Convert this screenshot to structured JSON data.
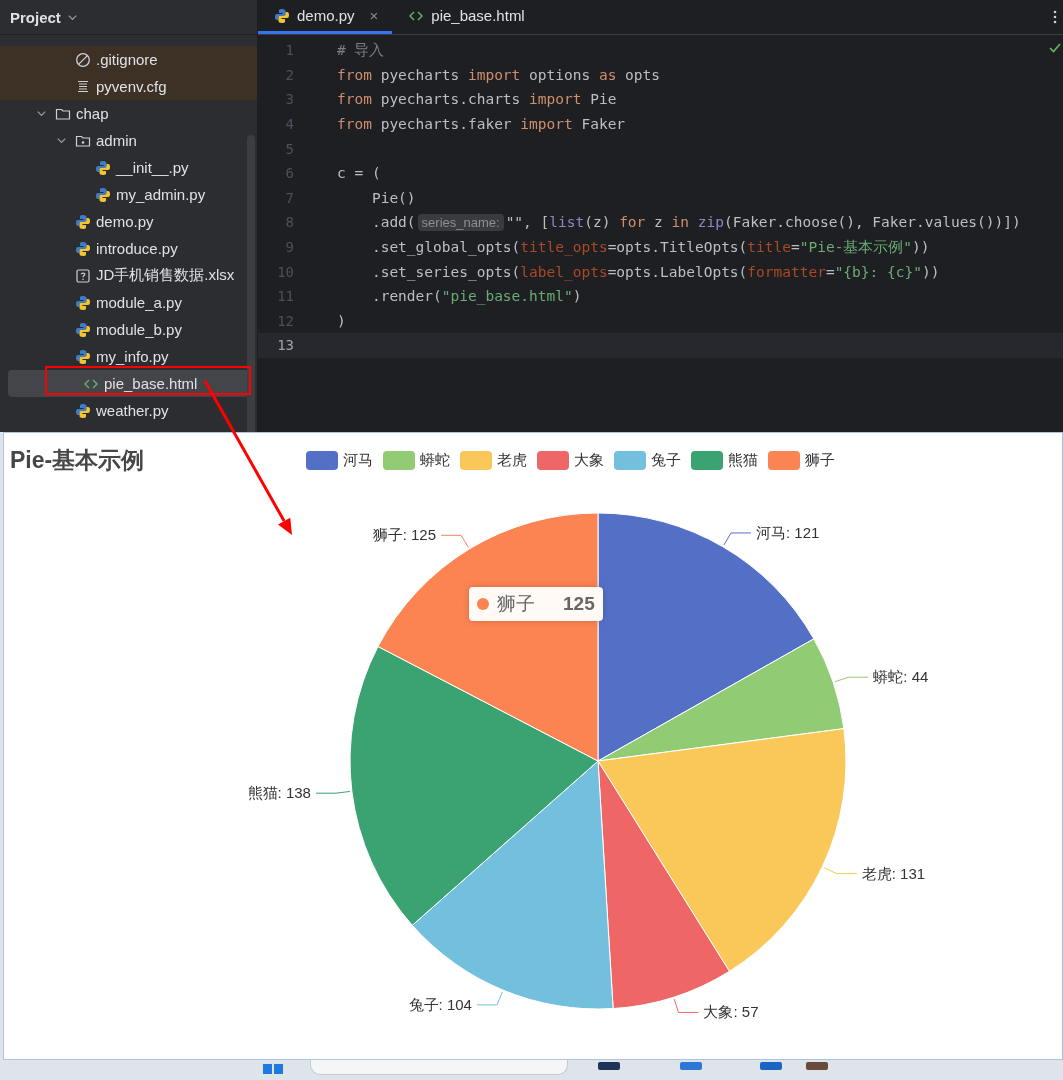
{
  "project_panel": {
    "title": "Project",
    "tree": [
      {
        "children": [
          {
            "label": ".gitignore",
            "kind": "ignore",
            "excluded": true,
            "selected": false
          },
          {
            "label": "pyvenv.cfg",
            "kind": "config",
            "excluded": true,
            "selected": false
          }
        ]
      },
      {
        "label": "chap",
        "kind": "folder",
        "expanded": true,
        "excluded": false,
        "selected": false,
        "children": [
          {
            "label": "admin",
            "kind": "package",
            "expanded": true,
            "excluded": false,
            "selected": false,
            "children": [
              {
                "label": "__init__.py",
                "kind": "python",
                "excluded": false,
                "selected": false
              },
              {
                "label": "my_admin.py",
                "kind": "python",
                "excluded": false,
                "selected": false
              }
            ]
          },
          {
            "label": "demo.py",
            "kind": "python",
            "excluded": false,
            "selected": false
          },
          {
            "label": "introduce.py",
            "kind": "python",
            "excluded": false,
            "selected": false
          },
          {
            "label": "JD手机销售数据.xlsx",
            "kind": "unknown",
            "excluded": false,
            "selected": false
          },
          {
            "label": "module_a.py",
            "kind": "python",
            "excluded": false,
            "selected": false
          },
          {
            "label": "module_b.py",
            "kind": "python",
            "excluded": false,
            "selected": false
          },
          {
            "label": "my_info.py",
            "kind": "python",
            "excluded": false,
            "selected": false
          },
          {
            "label": "pie_base.html",
            "kind": "html",
            "excluded": false,
            "selected": true
          },
          {
            "label": "weather.py",
            "kind": "python",
            "excluded": false,
            "selected": false
          }
        ]
      }
    ]
  },
  "editor": {
    "tabs": [
      {
        "label": "demo.py",
        "kind": "python",
        "selected": true,
        "close": "×"
      },
      {
        "label": "pie_base.html",
        "kind": "html",
        "selected": false
      }
    ],
    "lines": [
      {
        "number": "1",
        "current": false,
        "tokens": [
          {
            "t": "# 导入",
            "kind": "comment"
          }
        ]
      },
      {
        "number": "2",
        "current": false,
        "tokens": [
          {
            "t": "from",
            "kind": "kw"
          },
          {
            "t": " pyecharts ",
            "kind": "plain"
          },
          {
            "t": "import",
            "kind": "kw"
          },
          {
            "t": " options ",
            "kind": "plain"
          },
          {
            "t": "as",
            "kind": "kw"
          },
          {
            "t": " opts",
            "kind": "plain"
          }
        ]
      },
      {
        "number": "3",
        "current": false,
        "tokens": [
          {
            "t": "from",
            "kind": "kw"
          },
          {
            "t": " pyecharts.charts ",
            "kind": "plain"
          },
          {
            "t": "import",
            "kind": "kw"
          },
          {
            "t": " Pie",
            "kind": "plain"
          }
        ]
      },
      {
        "number": "4",
        "current": false,
        "tokens": [
          {
            "t": "from",
            "kind": "kw"
          },
          {
            "t": " pyecharts.faker ",
            "kind": "plain"
          },
          {
            "t": "import",
            "kind": "kw"
          },
          {
            "t": " Faker",
            "kind": "plain"
          }
        ]
      },
      {
        "number": "5",
        "current": false
      },
      {
        "number": "6",
        "current": false,
        "tokens": [
          {
            "t": "c = (",
            "kind": "plain"
          }
        ]
      },
      {
        "number": "7",
        "current": false,
        "tokens": [
          {
            "t": "    Pie()",
            "kind": "plain"
          }
        ]
      },
      {
        "number": "8",
        "current": false,
        "tokens": [
          {
            "t": "    .add(",
            "kind": "plain"
          },
          {
            "t": "series_name:",
            "kind": "hint"
          },
          {
            "t": "\"\"",
            "kind": "plain"
          },
          {
            "t": ", [",
            "kind": "plain"
          },
          {
            "t": "list",
            "kind": "builtin"
          },
          {
            "t": "(z) ",
            "kind": "plain"
          },
          {
            "t": "for",
            "kind": "kw"
          },
          {
            "t": " z ",
            "kind": "plain"
          },
          {
            "t": "in",
            "kind": "kw"
          },
          {
            "t": " zip",
            "kind": "builtin"
          },
          {
            "t": "(Faker.choose(), Faker.values())])",
            "kind": "plain"
          }
        ]
      },
      {
        "number": "9",
        "current": false,
        "tokens": [
          {
            "t": "    .set_global_opts(",
            "kind": "plain"
          },
          {
            "t": "title_opts",
            "kind": "param"
          },
          {
            "t": "=opts.TitleOpts(",
            "kind": "plain"
          },
          {
            "t": "title",
            "kind": "param"
          },
          {
            "t": "=",
            "kind": "plain"
          },
          {
            "t": "\"Pie-基本示例\"",
            "kind": "str"
          },
          {
            "t": "))",
            "kind": "plain"
          }
        ]
      },
      {
        "number": "10",
        "current": false,
        "tokens": [
          {
            "t": "    .set_series_opts(",
            "kind": "plain"
          },
          {
            "t": "label_opts",
            "kind": "param"
          },
          {
            "t": "=opts.LabelOpts(",
            "kind": "plain"
          },
          {
            "t": "formatter",
            "kind": "param"
          },
          {
            "t": "=",
            "kind": "plain"
          },
          {
            "t": "\"{b}: {c}\"",
            "kind": "str"
          },
          {
            "t": "))",
            "kind": "plain"
          }
        ]
      },
      {
        "number": "11",
        "current": false,
        "tokens": [
          {
            "t": "    .render(",
            "kind": "plain"
          },
          {
            "t": "\"pie_base.html\"",
            "kind": "str"
          },
          {
            "t": ")",
            "kind": "plain"
          }
        ]
      },
      {
        "number": "12",
        "current": false,
        "tokens": [
          {
            "t": ")",
            "kind": "plain"
          }
        ]
      },
      {
        "number": "13",
        "current": true
      }
    ]
  },
  "chart_panel": {
    "legend": [
      {
        "color": "#5470c6"
      },
      {
        "color": "#91cc75"
      },
      {
        "color": "#fac858"
      },
      {
        "color": "#ee6666"
      },
      {
        "color": "#73c0de"
      },
      {
        "color": "#3ba272"
      },
      {
        "color": "#fc8452"
      }
    ],
    "chart_data": {
      "type": "pie",
      "title": "Pie-基本示例",
      "categories": [
        "河马",
        "蟒蛇",
        "老虎",
        "大象",
        "兔子",
        "熊猫",
        "狮子"
      ],
      "values": [
        121,
        44,
        131,
        57,
        104,
        138,
        125
      ],
      "value_labels": [
        "河马: 121",
        "蟒蛇: 44",
        "老虎: 131",
        "大象: 57",
        "兔子: 104",
        "熊猫: 138",
        "狮子: 125"
      ]
    },
    "tooltip": {
      "label": "狮子",
      "value": "125",
      "color": "#fc8452"
    }
  },
  "annotations": [
    {
      "kind": "box",
      "color": "#ff0000"
    },
    {
      "kind": "arrow",
      "color": "#ff0000"
    }
  ]
}
